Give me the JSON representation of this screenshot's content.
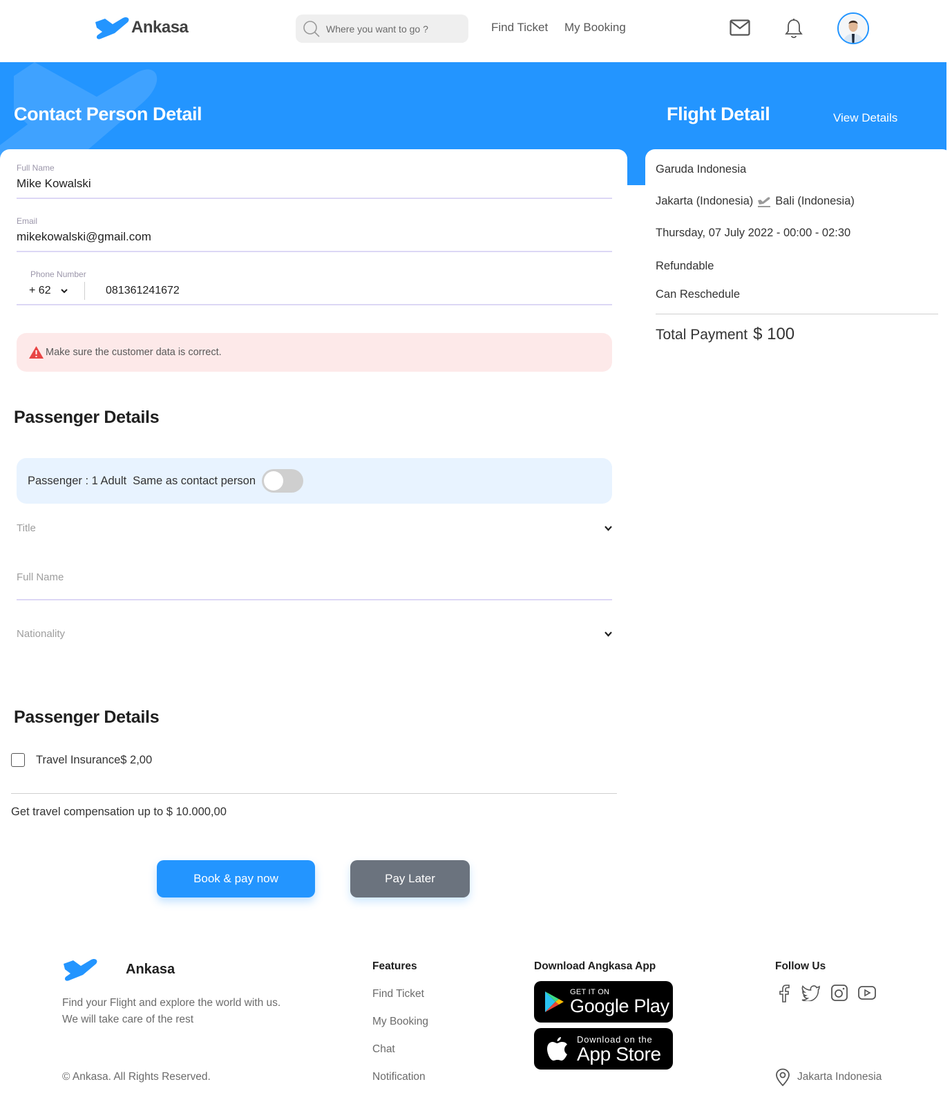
{
  "navbar": {
    "brand": "Ankasa",
    "search_placeholder": "Where you want to go ?",
    "links": [
      {
        "label": "Find Ticket"
      },
      {
        "label": "My Booking"
      }
    ],
    "icons": [
      "mail-icon",
      "bell-icon"
    ],
    "avatar": "user-avatar"
  },
  "header": {
    "contact_title": "Contact Person Detail",
    "flight_title": "Flight Detail",
    "view_details": "View Details"
  },
  "contact": {
    "full_name": {
      "label": "Full Name",
      "value": "Mike Kowalski"
    },
    "email": {
      "label": "Email",
      "value": "mikekowalski@gmail.com"
    },
    "phone": {
      "label": "Phone Number",
      "country_code": "+ 62",
      "number": "081361241672"
    },
    "alert": "Make sure the customer data is correct."
  },
  "passenger": {
    "title": "Passenger Details",
    "summary": "Passenger : 1 Adult",
    "same_as_contact_label": "Same as contact person",
    "same_as_contact_on": false,
    "title_select": {
      "placeholder": "Title"
    },
    "full_name": {
      "placeholder": "Full Name"
    },
    "nationality_select": {
      "placeholder": "Nationality"
    }
  },
  "insurance": {
    "title": "Passenger Details",
    "checkbox_label": "Travel Insurance$ 2,00",
    "checked": false,
    "compensation": "Get travel compensation up to $ 10.000,00"
  },
  "actions": {
    "book_now": "Book & pay now",
    "pay_later": "Pay Later"
  },
  "flight": {
    "airline": "Garuda Indonesia",
    "from": "Jakarta (Indonesia)",
    "to": "Bali (Indonesia)",
    "schedule": "Thursday, 07 July 2022 - 00:00 - 02:30",
    "refundable": "Refundable",
    "reschedule": "Can Reschedule",
    "total_label": "Total Payment",
    "total_amount": "$ 100"
  },
  "footer": {
    "brand": "Ankasa",
    "description": "Find your Flight and explore the world with us. We will take care of the rest",
    "copyright": "© Ankasa. All Rights Reserved.",
    "features_title": "Features",
    "features": [
      {
        "label": "Find Ticket"
      },
      {
        "label": "My Booking"
      },
      {
        "label": "Chat"
      },
      {
        "label": "Notification"
      }
    ],
    "download_title": "Download Angkasa App",
    "google_play": {
      "small": "GET IT ON",
      "big": "Google Play"
    },
    "app_store": {
      "small": "Download on the",
      "big": "App Store"
    },
    "follow_title": "Follow Us",
    "social": [
      "facebook-icon",
      "twitter-icon",
      "instagram-icon",
      "youtube-icon"
    ],
    "location": "Jakarta Indonesia"
  },
  "colors": {
    "primary": "#2395ff",
    "secondary_button": "#6b737e",
    "alert_bg": "#fde9e9",
    "alert_icon": "#e84545",
    "passenger_bar_bg": "#e8f3ff"
  }
}
